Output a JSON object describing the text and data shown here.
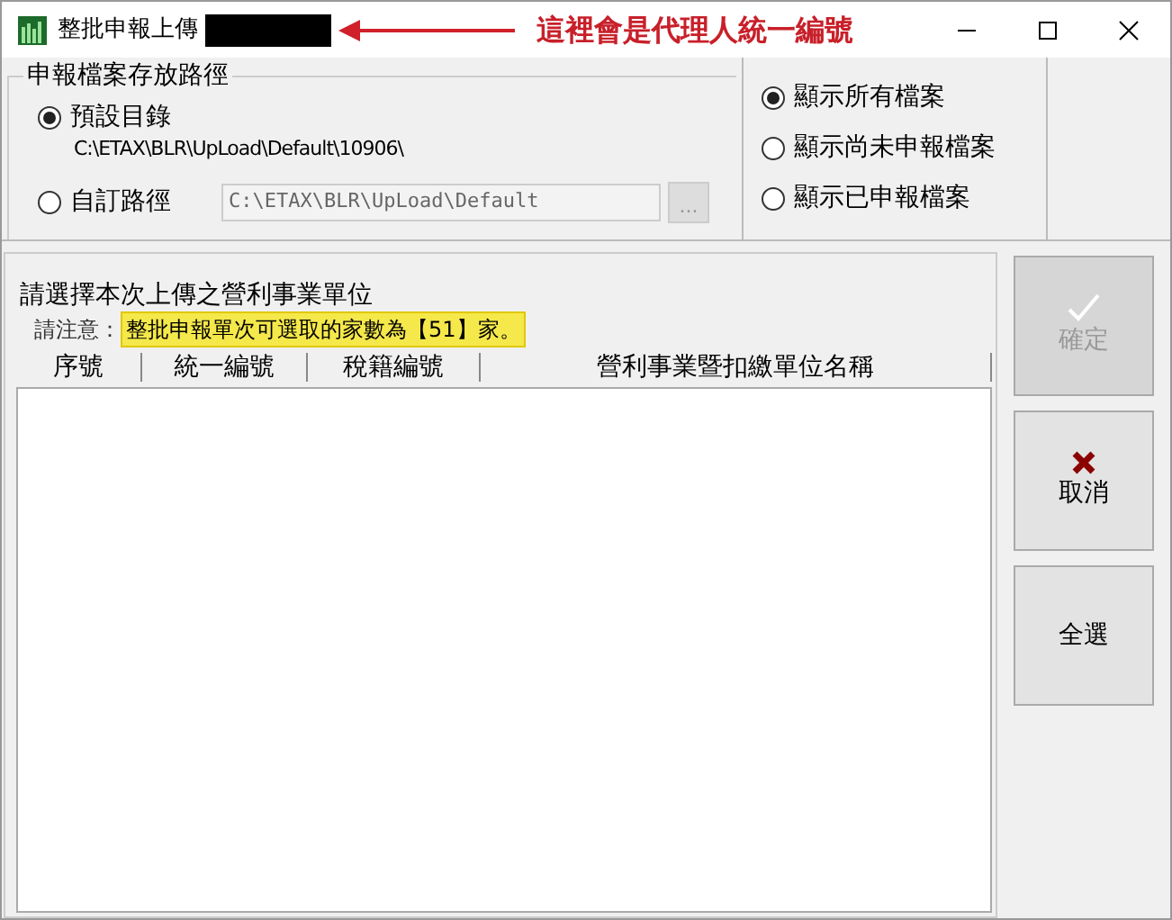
{
  "window": {
    "title": "整批申報上傳"
  },
  "annotation": {
    "text": "這裡會是代理人統一編號"
  },
  "path_group": {
    "legend": "申報檔案存放路徑",
    "options": [
      {
        "label": "預設目錄",
        "selected": true,
        "path": "C:\\ETAX\\BLR\\UpLoad\\Default\\10906\\"
      },
      {
        "label": "自訂路徑",
        "selected": false,
        "field_value": "C:\\ETAX\\BLR\\UpLoad\\Default",
        "browse_label": "..."
      }
    ]
  },
  "filter": [
    {
      "label": "顯示所有檔案",
      "selected": true
    },
    {
      "label": "顯示尚未申報檔案",
      "selected": false
    },
    {
      "label": "顯示已申報檔案",
      "selected": false
    }
  ],
  "unit_list": {
    "heading": "請選擇本次上傳之營利事業單位",
    "notice_label": "請注意：",
    "notice": "整批申報單次可選取的家數為【51】家。",
    "columns": [
      "序號",
      "統一編號",
      "稅籍編號",
      "營利事業暨扣繳單位名稱"
    ]
  },
  "buttons": [
    {
      "kind": "confirm",
      "label": "確定",
      "disabled": true
    },
    {
      "kind": "cancel",
      "label": "取消",
      "disabled": false
    },
    {
      "kind": "select_all",
      "label": "全選",
      "disabled": false
    }
  ]
}
